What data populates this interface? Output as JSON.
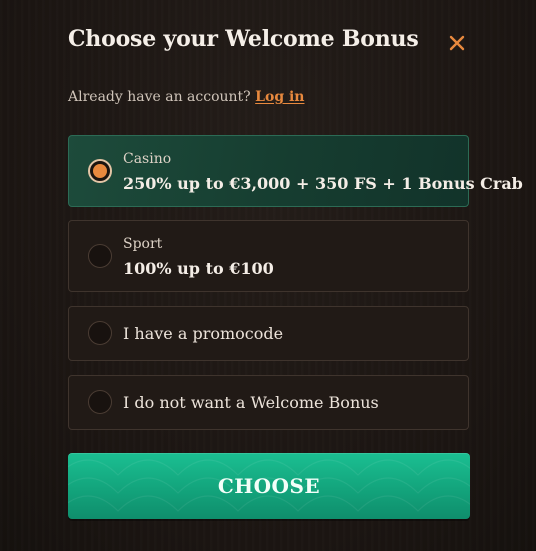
{
  "modal": {
    "title": "Choose your Welcome Bonus",
    "close_icon": "close-icon",
    "accent_color": "#e8893e"
  },
  "account": {
    "prompt": "Already have an account?",
    "login_link": "Log in"
  },
  "options": [
    {
      "label": "Casino",
      "value": "250% up to €3,000 + 350 FS + 1 Bonus Crab",
      "selected": true
    },
    {
      "label": "Sport",
      "value": "100% up to €100",
      "selected": false
    },
    {
      "label": "I have a promocode",
      "selected": false
    },
    {
      "label": "I do not want a Welcome Bonus",
      "selected": false
    }
  ],
  "choose_button": {
    "label": "CHOOSE",
    "color": "#13a47c"
  }
}
